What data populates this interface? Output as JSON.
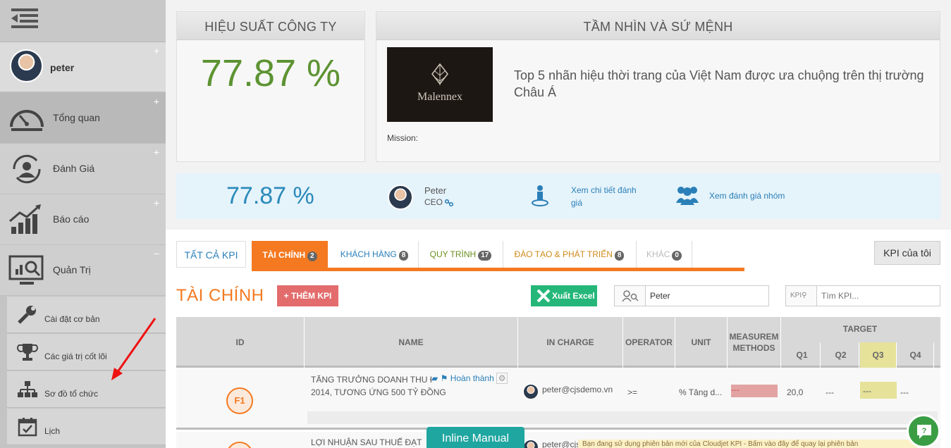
{
  "sidebar": {
    "username": "peter",
    "nav": [
      {
        "label": "Tổng quan",
        "icon": "dashboard-gauge-icon"
      },
      {
        "label": "Đánh Giá",
        "icon": "user-refresh-icon"
      },
      {
        "label": "Báo cáo",
        "icon": "bar-chart-up-icon"
      },
      {
        "label": "Quản Trị",
        "icon": "monitor-search-icon"
      }
    ],
    "plus_glyph": "+",
    "minus_glyph": "−",
    "sub": [
      {
        "label": "Cài đặt cơ bản",
        "icon": "wrench-icon"
      },
      {
        "label": "Các giá trị cốt lõi",
        "icon": "trophy-icon"
      },
      {
        "label": "Sơ đồ tổ chức",
        "icon": "org-chart-icon"
      },
      {
        "label": "Lịch",
        "icon": "calendar-icon"
      }
    ]
  },
  "performance": {
    "title": "HIỆU SUẤT CÔNG TY",
    "value": "77.87 %"
  },
  "vision": {
    "title": "TẦM NHÌN VÀ SỨ MỆNH",
    "logo_text": "Malennex",
    "text": "Top 5 nhãn hiệu thời trang của Việt Nam được ưa chuộng trên thị trường Châu Á",
    "mission_label": "Mission:"
  },
  "info_bar": {
    "value": "77.87 %",
    "name": "Peter",
    "role": "CEO",
    "detail_link": "Xem chi tiết đánh giá",
    "group_link": "Xem đánh giá nhóm"
  },
  "tabs": [
    {
      "label": "TẤT CẢ KPI",
      "count": ""
    },
    {
      "label": "TÀI CHÍNH",
      "count": "2"
    },
    {
      "label": "KHÁCH HÀNG",
      "count": "8"
    },
    {
      "label": "QUY TRÌNH",
      "count": "17"
    },
    {
      "label": "ĐÀO TẠO & PHÁT TRIỂN",
      "count": "8"
    },
    {
      "label": "KHÁC",
      "count": "0"
    }
  ],
  "my_kpi_button": "KPI của tôi",
  "section_title": "TÀI CHÍNH",
  "add_kpi": "+ THÊM KPI",
  "export_excel": "Xuất Excel",
  "search_person_value": "Peter",
  "search_kpi": {
    "addon": "KPI",
    "placeholder": "Tìm KPI..."
  },
  "table": {
    "headers": {
      "id": "ID",
      "name": "NAME",
      "in_charge": "IN CHARGE",
      "operator": "OPERATOR",
      "unit": "UNIT",
      "measure": "MEASUREM METHODS",
      "target": "TARGET"
    },
    "quarters": [
      "Q1",
      "Q2",
      "Q3",
      "Q4"
    ],
    "row1": {
      "id": "F1",
      "name": "TĂNG TRƯỞNG DOANH THU ĐẠT 20% SO VỚI 2014, TƯƠNG ỨNG 500 TỶ ĐỒNG",
      "status": "Hoàn thành",
      "in_charge": "peter@cjsdemo.vn",
      "operator": ">=",
      "unit": "% Tăng d...",
      "measure": "---",
      "q1": "20,0",
      "q2": "---",
      "q3": "---",
      "q4": "---"
    },
    "row2": {
      "name": "LỢI NHUẬN SAU THUẾ ĐẠT",
      "in_charge": "peter@cjs"
    }
  },
  "inline_manual": "Inline Manual",
  "notice": "Bạn đang sử dụng phiên bản mới của Cloudjet KPI - Bấm vào đây để quay lại phiên bản",
  "colors": {
    "accent_orange": "#f47920",
    "perf_green": "#5d9332",
    "info_blue": "#2a8ab9"
  }
}
